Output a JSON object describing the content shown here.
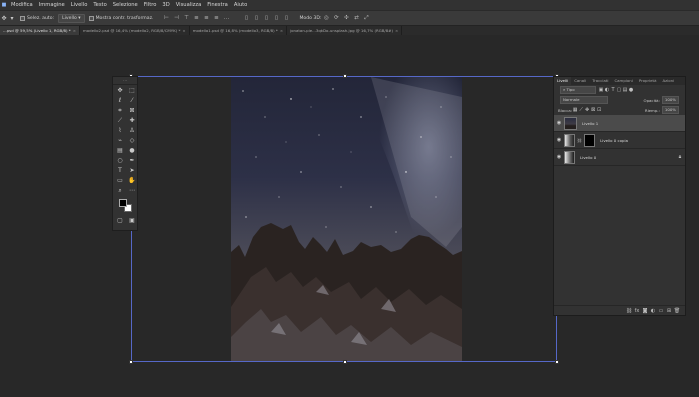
{
  "menu": {
    "app_icon": "photoshop-icon",
    "items": [
      "Modifica",
      "Immagine",
      "Livello",
      "Testo",
      "Selezione",
      "Filtro",
      "3D",
      "Visualizza",
      "Finestra",
      "Aiuto"
    ]
  },
  "options": {
    "move_icon": "move-tool-icon",
    "auto_select_label": "Selez. auto:",
    "auto_select_value": "Livello",
    "show_transform_label": "Mostra contr. trasformaz.",
    "align_icons": [
      "align-left-icon",
      "align-center-icon",
      "align-right-icon",
      "align-top-icon",
      "align-middle-icon",
      "align-bottom-icon",
      "more-icon"
    ],
    "mode_3d_label": "Modo 3D:"
  },
  "tabs": [
    {
      "label": "...psd @ 59,5% (Livello 1, RGB/8) *",
      "active": true
    },
    {
      "label": "modello2.psd @ 16,4% (modello2, RGB/8/CMYK) *",
      "active": false
    },
    {
      "label": "modello1.psd @ 16,8% (modello3, RGB/8) *",
      "active": false
    },
    {
      "label": "jonatan-pie...3qkDo-unsplash.jpg @ 16,7% (RGB/8#)",
      "active": false
    }
  ],
  "toolbar": {
    "tools": [
      "move-icon",
      "marquee-icon",
      "lasso-icon",
      "magic-wand-icon",
      "crop-icon",
      "frame-icon",
      "eyedropper-icon",
      "healing-icon",
      "brush-icon",
      "stamp-icon",
      "history-brush-icon",
      "eraser-icon",
      "gradient-icon",
      "blur-icon",
      "dodge-icon",
      "pen-icon",
      "type-icon",
      "path-select-icon",
      "rectangle-icon",
      "hand-icon",
      "zoom-icon",
      "more-tools-icon"
    ],
    "foreground": "#000000",
    "background": "#ffffff"
  },
  "layers_panel": {
    "tabs": [
      "Livelli",
      "Canali",
      "Tracciati",
      "Campioni",
      "Proprietà",
      "Azioni"
    ],
    "filter_label": "Tipo",
    "blend_mode": "Normale",
    "opacity_label": "Opacità:",
    "opacity_value": "100%",
    "lock_label": "Blocca:",
    "fill_label": "Riemp.:",
    "fill_value": "100%",
    "layers": [
      {
        "name": "Livello 1",
        "active": true,
        "locked": false
      },
      {
        "name": "Livello 0 copia",
        "active": false,
        "locked": false
      },
      {
        "name": "Livello 0",
        "active": false,
        "locked": true
      }
    ],
    "footer_icons": [
      "link-icon",
      "fx-icon",
      "mask-icon",
      "adjustment-icon",
      "group-icon",
      "new-layer-icon",
      "trash-icon"
    ]
  },
  "colors": {
    "accent": "#5668c8",
    "panel": "#323232",
    "workspace": "#282828"
  }
}
